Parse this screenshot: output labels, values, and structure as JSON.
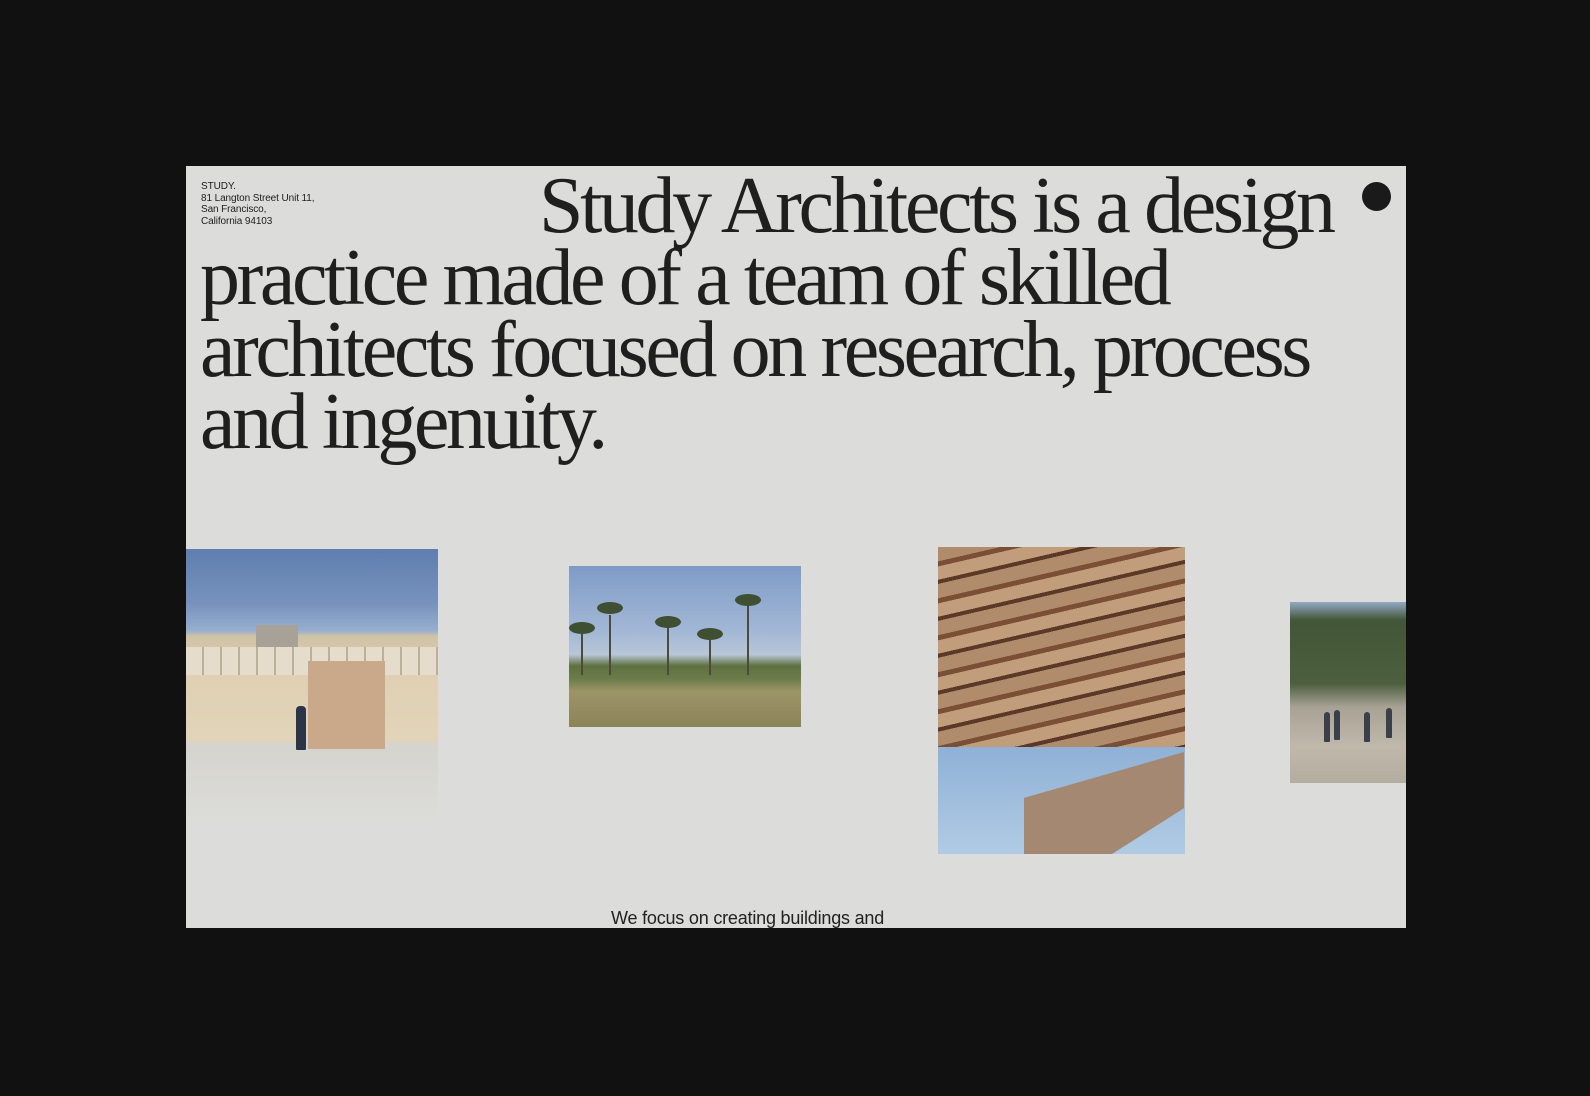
{
  "site": {
    "address": {
      "name": "STUDY.",
      "line1": "81 Langton Street Unit 11,",
      "line2": "San Francisco,",
      "line3": "California 94103"
    },
    "headline": "Study Architects is a design practice made of a team of skilled architects focused on research, process and ingenuity.",
    "intro_text": "We focus on creating buildings and"
  },
  "images": [
    {
      "subject": "stone-quarry-wall"
    },
    {
      "subject": "palm-tree-field"
    },
    {
      "subject": "wood-slat-canopy"
    },
    {
      "subject": "site-visit-trees"
    }
  ],
  "colors": {
    "background": "#111111",
    "page": "#dcdcda",
    "text": "#1f1f1f"
  }
}
